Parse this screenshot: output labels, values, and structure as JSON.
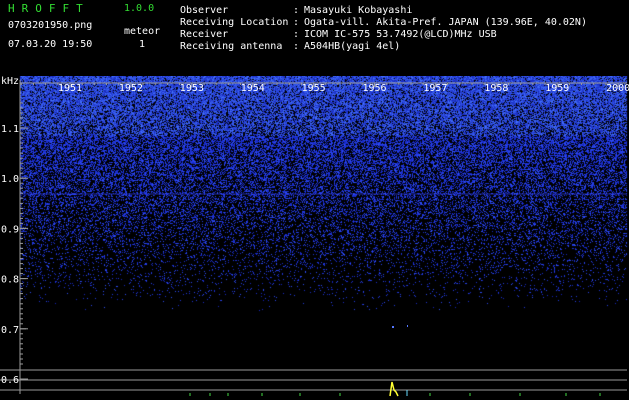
{
  "app": {
    "title": "HROFFT",
    "version": "1.0.0",
    "file_name": "0703201950.png",
    "timestamp": "07.03.20 19:50",
    "meteor_label": "meteor",
    "meteor_count": "1"
  },
  "info": [
    {
      "label": "Observer",
      "value": "Masayuki Kobayashi"
    },
    {
      "label": "Receiving Location",
      "value": "Ogata-vill. Akita-Pref. JAPAN (139.96E, 40.02N)"
    },
    {
      "label": "Receiver",
      "value": "ICOM IC-575 53.7492(@LCD)MHz USB"
    },
    {
      "label": "Receiving antenna",
      "value": "A504HB(yagi 4el)"
    }
  ],
  "plot": {
    "y_unit": "kHz",
    "x_ticks": [
      "1951",
      "1952",
      "1953",
      "1954",
      "1955",
      "1956",
      "1957",
      "1958",
      "1959",
      "2000"
    ],
    "y_ticks": [
      "1.1",
      "1.0",
      "0.9",
      "0.8",
      "0.7",
      "0.6"
    ],
    "colors": {
      "noise": "#2a3cff",
      "axis": "#9a9a9a",
      "label": "#ffffff",
      "meteor": "#ffff33",
      "spectrum": "#ffee33"
    }
  }
}
